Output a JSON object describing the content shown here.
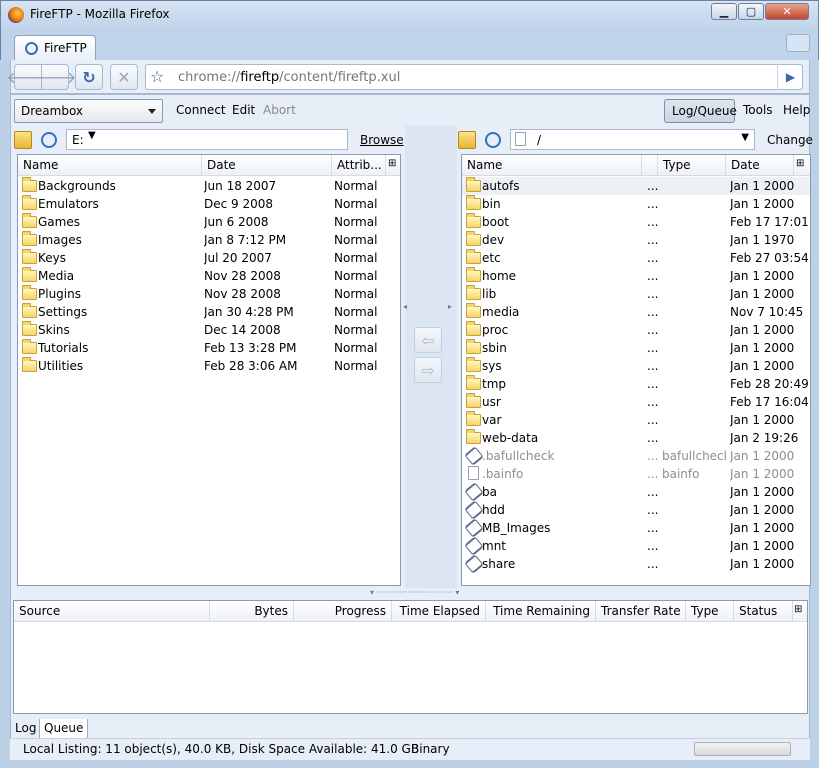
{
  "window": {
    "title": "FireFTP - Mozilla Firefox"
  },
  "tabs": [
    {
      "label": "FireFTP"
    }
  ],
  "url": {
    "prefix": "chrome://",
    "host": "fireftp",
    "path": "/content/fireftp.xul"
  },
  "toolbar": {
    "site": "Dreambox",
    "connect": "Connect",
    "edit": "Edit",
    "abort": "Abort",
    "log_queue": "Log/Queue",
    "tools": "Tools",
    "help": "Help"
  },
  "local": {
    "path": "E:",
    "browse": "Browse",
    "columns": {
      "name": "Name",
      "date": "Date",
      "attrib": "Attrib..."
    },
    "items": [
      {
        "name": "Backgrounds",
        "date": "Jun 18 2007",
        "attrib": "Normal"
      },
      {
        "name": "Emulators",
        "date": "Dec 9 2008",
        "attrib": "Normal"
      },
      {
        "name": "Games",
        "date": "Jun 6 2008",
        "attrib": "Normal"
      },
      {
        "name": "Images",
        "date": "Jan 8 7:12 PM",
        "attrib": "Normal"
      },
      {
        "name": "Keys",
        "date": "Jul 20 2007",
        "attrib": "Normal"
      },
      {
        "name": "Media",
        "date": "Nov 28 2008",
        "attrib": "Normal"
      },
      {
        "name": "Plugins",
        "date": "Nov 28 2008",
        "attrib": "Normal"
      },
      {
        "name": "Settings",
        "date": "Jan 30 4:28 PM",
        "attrib": "Normal"
      },
      {
        "name": "Skins",
        "date": "Dec 14 2008",
        "attrib": "Normal"
      },
      {
        "name": "Tutorials",
        "date": "Feb 13 3:28 PM",
        "attrib": "Normal"
      },
      {
        "name": "Utilities",
        "date": "Feb 28 3:06 AM",
        "attrib": "Normal"
      }
    ]
  },
  "remote": {
    "path": "/",
    "change": "Change",
    "columns": {
      "name": "Name",
      "type": "Type",
      "date": "Date"
    },
    "items": [
      {
        "name": "autofs",
        "size": "...",
        "type": "",
        "date": "Jan 1 2000",
        "kind": "folder"
      },
      {
        "name": "bin",
        "size": "...",
        "type": "",
        "date": "Jan 1 2000",
        "kind": "folder"
      },
      {
        "name": "boot",
        "size": "...",
        "type": "",
        "date": "Feb 17 17:01",
        "kind": "folder"
      },
      {
        "name": "dev",
        "size": "...",
        "type": "",
        "date": "Jan 1 1970",
        "kind": "folder"
      },
      {
        "name": "etc",
        "size": "...",
        "type": "",
        "date": "Feb 27 03:54",
        "kind": "folder"
      },
      {
        "name": "home",
        "size": "...",
        "type": "",
        "date": "Jan 1 2000",
        "kind": "folder"
      },
      {
        "name": "lib",
        "size": "...",
        "type": "",
        "date": "Jan 1 2000",
        "kind": "folder"
      },
      {
        "name": "media",
        "size": "...",
        "type": "",
        "date": "Nov 7 10:45",
        "kind": "folder"
      },
      {
        "name": "proc",
        "size": "...",
        "type": "",
        "date": "Jan 1 2000",
        "kind": "folder"
      },
      {
        "name": "sbin",
        "size": "...",
        "type": "",
        "date": "Jan 1 2000",
        "kind": "folder"
      },
      {
        "name": "sys",
        "size": "...",
        "type": "",
        "date": "Jan 1 2000",
        "kind": "folder"
      },
      {
        "name": "tmp",
        "size": "...",
        "type": "",
        "date": "Feb 28 20:49",
        "kind": "folder"
      },
      {
        "name": "usr",
        "size": "...",
        "type": "",
        "date": "Feb 17 16:04",
        "kind": "folder"
      },
      {
        "name": "var",
        "size": "...",
        "type": "",
        "date": "Jan 1 2000",
        "kind": "folder"
      },
      {
        "name": "web-data",
        "size": "...",
        "type": "",
        "date": "Jan 2 19:26",
        "kind": "folder"
      },
      {
        "name": ".bafullcheck",
        "size": "...",
        "type": "bafullcheck",
        "date": "Jan 1 2000",
        "kind": "link-hidden"
      },
      {
        "name": ".bainfo",
        "size": "...",
        "type": "bainfo",
        "date": "Jan 1 2000",
        "kind": "file-hidden"
      },
      {
        "name": "ba",
        "size": "...",
        "type": "",
        "date": "Jan 1 2000",
        "kind": "link"
      },
      {
        "name": "hdd",
        "size": "...",
        "type": "",
        "date": "Jan 1 2000",
        "kind": "link"
      },
      {
        "name": "MB_Images",
        "size": "...",
        "type": "",
        "date": "Jan 1 2000",
        "kind": "link"
      },
      {
        "name": "mnt",
        "size": "...",
        "type": "",
        "date": "Jan 1 2000",
        "kind": "link"
      },
      {
        "name": "share",
        "size": "...",
        "type": "",
        "date": "Jan 1 2000",
        "kind": "link"
      }
    ]
  },
  "queue": {
    "columns": [
      "Source",
      "Bytes",
      "Progress",
      "Time Elapsed",
      "Time Remaining",
      "Transfer Rate",
      "Type",
      "Status"
    ]
  },
  "bottom_tabs": {
    "log": "Log",
    "queue": "Queue"
  },
  "status": {
    "listing": "Local Listing: 11 object(s), 40.0 KB, Disk Space Available: 41.0 GB",
    "mode": "Binary"
  }
}
